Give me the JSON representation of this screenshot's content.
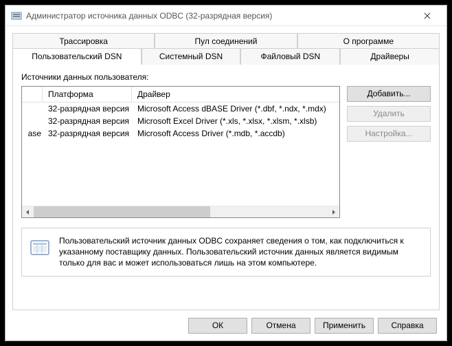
{
  "titlebar": {
    "title": "Администратор источника данных ODBC (32-разрядная версия)"
  },
  "tabs_top": {
    "t0": "Трассировка",
    "t1": "Пул соединений",
    "t2": "О программе"
  },
  "tabs_bottom": {
    "t0": "Пользовательский DSN",
    "t1": "Системный DSN",
    "t2": "Файловый DSN",
    "t3": "Драйверы"
  },
  "panel": {
    "sources_label": "Источники данных пользователя:",
    "columns": {
      "c1": "Платформа",
      "c2": "Драйвер"
    },
    "rows": [
      {
        "c0": "",
        "c1": "32-разрядная версия",
        "c2": "Microsoft Access dBASE Driver (*.dbf, *.ndx, *.mdx)"
      },
      {
        "c0": "",
        "c1": "32-разрядная версия",
        "c2": "Microsoft Excel Driver (*.xls, *.xlsx, *.xlsm, *.xlsb)"
      },
      {
        "c0": "ase",
        "c1": "32-разрядная версия",
        "c2": "Microsoft Access Driver (*.mdb, *.accdb)"
      }
    ],
    "buttons": {
      "add": "Добавить...",
      "remove": "Удалить",
      "configure": "Настройка..."
    },
    "info": "Пользовательский источник данных ODBC сохраняет сведения о том, как подключиться к указанному поставщику данных.  Пользовательский источник данных является видимым только для вас и может использоваться лишь на этом компьютере."
  },
  "footer": {
    "ok": "ОК",
    "cancel": "Отмена",
    "apply": "Применить",
    "help": "Справка"
  }
}
